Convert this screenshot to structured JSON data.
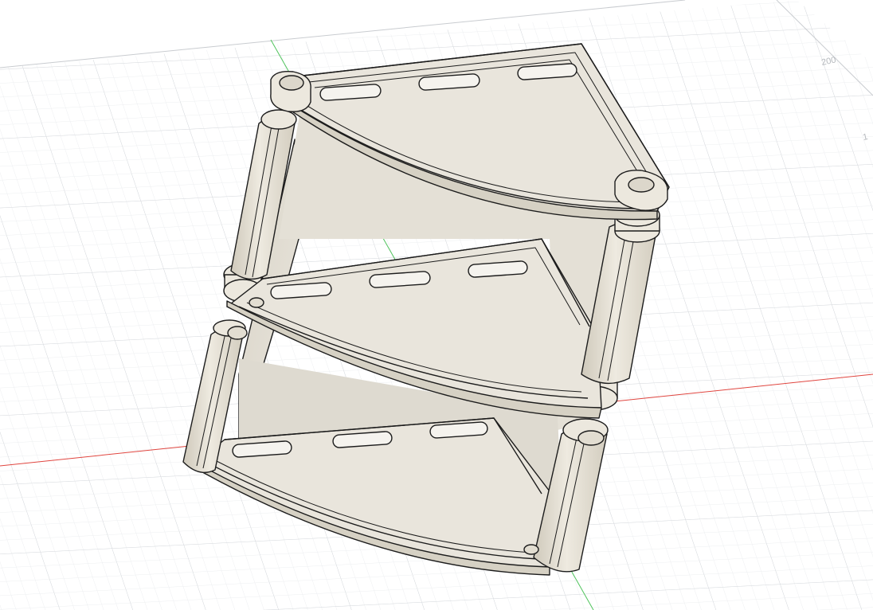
{
  "viewport": {
    "grid_labels": [
      "200",
      "1"
    ],
    "colors": {
      "background": "#ffffff",
      "grid_minor": "#eceef0",
      "grid_major": "#d6d9dd",
      "x_axis": "#e0453f",
      "y_axis": "#4fc35c",
      "model_face": "#e7e3d9",
      "model_face_dark": "#d9d4c8",
      "model_edge": "#1c1c1c"
    },
    "model": {
      "name": "corner-shelf",
      "tier_count": 3
    }
  }
}
